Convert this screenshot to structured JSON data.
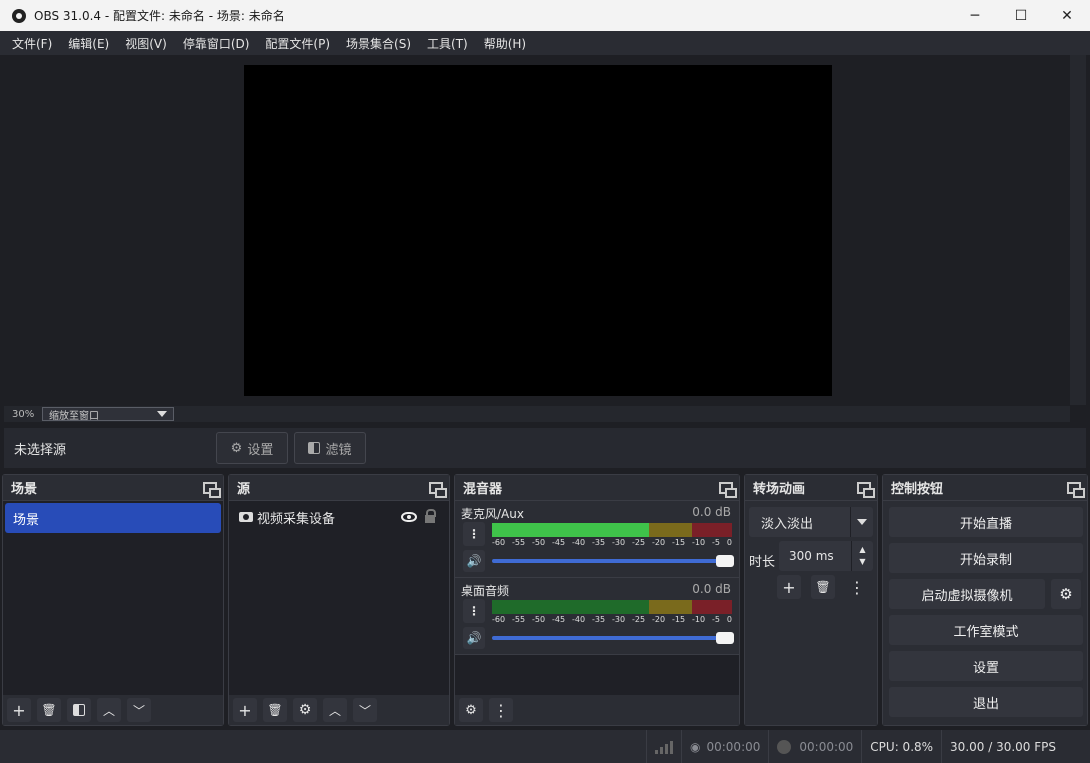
{
  "window": {
    "title": "OBS 31.0.4 - 配置文件: 未命名 - 场景: 未命名",
    "minimize": "─",
    "maximize": "☐",
    "close": "✕"
  },
  "menu": [
    "文件(F)",
    "编辑(E)",
    "视图(V)",
    "停靠窗口(D)",
    "配置文件(P)",
    "场景集合(S)",
    "工具(T)",
    "帮助(H)"
  ],
  "preview": {
    "zoom_percent": "30%",
    "zoom_mode": "缩放至窗口"
  },
  "source_toolbar": {
    "no_source": "未选择源",
    "settings_label": "设置",
    "filters_label": "滤镜"
  },
  "scenes": {
    "title": "场景",
    "items": [
      "场景"
    ]
  },
  "sources": {
    "title": "源",
    "items": [
      {
        "name": "视频采集设备",
        "visible": true,
        "locked": false
      }
    ]
  },
  "mixer": {
    "title": "混音器",
    "tracks": [
      {
        "name": "麦克风/Aux",
        "db": "0.0 dB",
        "active": true
      },
      {
        "name": "桌面音频",
        "db": "0.0 dB",
        "active": false
      }
    ],
    "scale": [
      "-60",
      "-55",
      "-50",
      "-45",
      "-40",
      "-35",
      "-30",
      "-25",
      "-20",
      "-15",
      "-10",
      "-5",
      "0"
    ]
  },
  "transitions": {
    "title": "转场动画",
    "current": "淡入淡出",
    "duration_label": "时长",
    "duration": "300 ms"
  },
  "controls": {
    "title": "控制按钮",
    "start_stream": "开始直播",
    "start_record": "开始录制",
    "virtual_cam": "启动虚拟摄像机",
    "studio_mode": "工作室模式",
    "settings": "设置",
    "exit": "退出"
  },
  "status": {
    "stream_time": "00:00:00",
    "record_time": "00:00:00",
    "cpu": "CPU: 0.8%",
    "fps": "30.00 / 30.00 FPS"
  },
  "colors": {
    "accent": "#284cb8",
    "meter_green": "#3fc34a",
    "meter_yellow": "#c9a227",
    "meter_red": "#c8343f"
  }
}
